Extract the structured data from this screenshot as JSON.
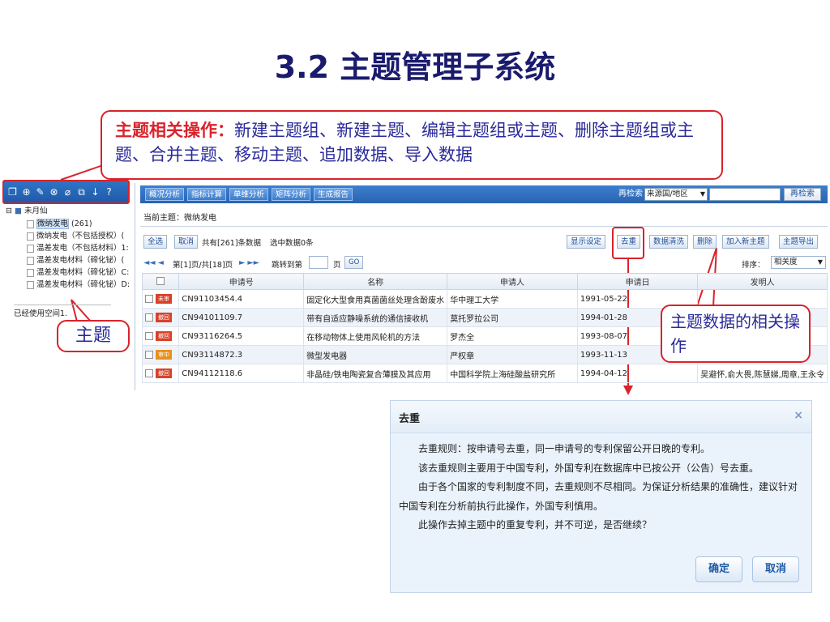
{
  "slide": {
    "title": "3.2 主题管理子系统"
  },
  "callouts": {
    "topic_ops_heading": "主题相关操作：",
    "topic_ops_text": "新建主题组、新建主题、编辑主题组或主题、删除主题组或主题、合并主题、移动主题、追加数据、导入数据",
    "topic_label": "主题",
    "data_ops_label": "主题数据的相关操作"
  },
  "tree": {
    "root": "未月仙",
    "nodes": [
      {
        "label": "微纳发电",
        "count": "(261)",
        "selected": true
      },
      {
        "label": "微纳发电（不包括授权）("
      },
      {
        "label": "温差发电（不包括材料）1:"
      },
      {
        "label": "温差发电材料（碲化铋）("
      },
      {
        "label": "温差发电材料（碲化铋）C:"
      },
      {
        "label": "温差发电材料（碲化铋）D:"
      }
    ],
    "space_used": "已经使用空间1."
  },
  "topbar": {
    "tabs": [
      "概况分析",
      "指标计算",
      "单维分析",
      "矩阵分析",
      "生成报告"
    ],
    "re_search_label": "再检索",
    "select_value": "来源国/地区",
    "re_search_button": "再检索"
  },
  "current_topic": "当前主题：微纳发电",
  "actions": {
    "select_all": "全选",
    "cancel": "取消",
    "total_info": "共有[261]条数据",
    "selected_info": "选中数据0条",
    "display_settings": "显示设定",
    "dedupe": "去重",
    "data_cleaning": "数据清洗",
    "delete": "删除",
    "add_new_topic": "加入新主题",
    "export_topic": "主题导出"
  },
  "pager": {
    "arrows_left": "◄◄ ◄",
    "page_info": "第[1]页/共[18]页",
    "arrows_right": "► ►►",
    "jump_to": "跳转到第",
    "page_unit": "页",
    "go": "GO",
    "sort_label": "排序：",
    "sort_value": "相关度"
  },
  "table": {
    "columns": [
      "申请号",
      "名称",
      "申请人",
      "申请日",
      "发明人"
    ],
    "rows": [
      {
        "badge": "未审",
        "badge_color": "#d9412a",
        "appno": "CN91103454.4",
        "name": "固定化大型食用真菌菌丝处理含酚废水",
        "applicant": "华中理工大学",
        "date": "1991-05-22",
        "inventor": ""
      },
      {
        "badge": "撤回",
        "badge_color": "#d9412a",
        "appno": "CN94101109.7",
        "name": "带有自适应静噪系统的通信接收机",
        "applicant": "莫托罗拉公司",
        "date": "1994-01-28",
        "inventor": ""
      },
      {
        "badge": "撤回",
        "badge_color": "#d9412a",
        "appno": "CN93116264.5",
        "name": "在移动物体上使用风轮机的方法",
        "applicant": "罗杰全",
        "date": "1993-08-07",
        "inventor": ""
      },
      {
        "badge": "审中",
        "badge_color": "#e9901d",
        "appno": "CN93114872.3",
        "name": "微型发电器",
        "applicant": "严权章",
        "date": "1993-11-13",
        "inventor": ""
      },
      {
        "badge": "撤回",
        "badge_color": "#d9412a",
        "appno": "CN94112118.6",
        "name": "非晶硅/铁电陶瓷复合薄膜及其应用",
        "applicant": "中国科学院上海硅酸盐研究所",
        "date": "1994-04-12",
        "inventor": "吴避怀,俞大畏,陈慧娣,周章,王永令"
      }
    ]
  },
  "dialog": {
    "title": "去重",
    "close": "×",
    "paragraphs": [
      "去重规则：按申请号去重，同一申请号的专利保留公开日晚的专利。",
      "该去重规则主要用于中国专利，外国专利在数据库中已按公开（公告）号去重。",
      "由于各个国家的专利制度不同，去重规则不尽相同。为保证分析结果的准确性，建议针对中国专利在分析前执行此操作，外国专利慎用。",
      "此操作去掉主题中的重复专利，并不可逆，是否继续？"
    ],
    "ok": "确定",
    "cancel": "取消"
  }
}
